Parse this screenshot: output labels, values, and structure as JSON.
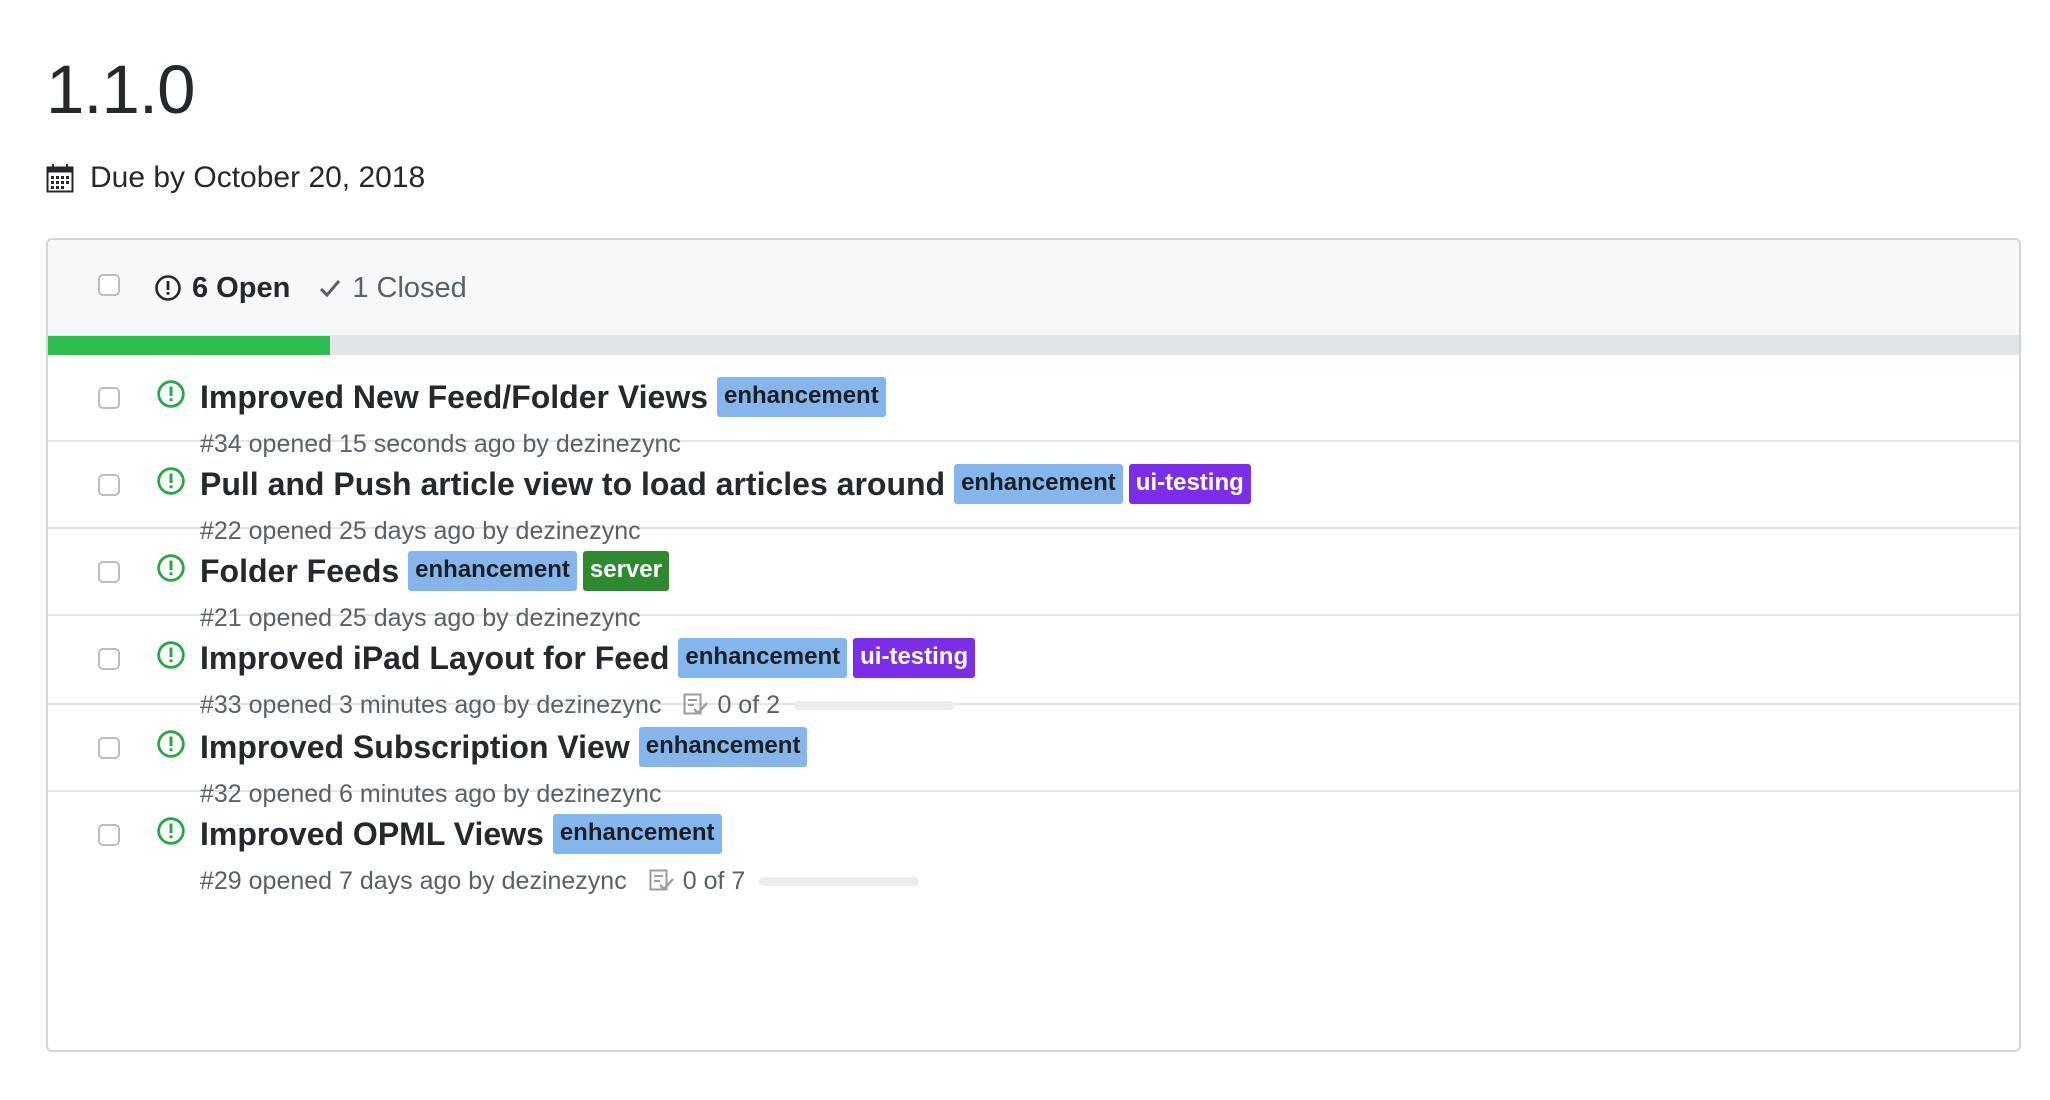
{
  "milestone": {
    "title": "1.1.0",
    "due_text": "Due by October 20, 2018",
    "progress_fraction": 0.143
  },
  "filters": {
    "open_label": "6 Open",
    "closed_label": "1 Closed"
  },
  "colors": {
    "enhancement": "#84b6eb",
    "ui-testing": "#7b2de8",
    "server": "#2e8a2e",
    "progress": "#2cbe4e",
    "open_icon": "#28a745"
  },
  "issues": [
    {
      "title": "Improved New Feed/Folder Views",
      "labels": [
        {
          "name": "enhancement",
          "key": "enhancement"
        }
      ],
      "meta": "#34 opened 15 seconds ago by dezinezync",
      "tasks": null
    },
    {
      "title": "Pull and Push article view to load articles around",
      "labels": [
        {
          "name": "enhancement",
          "key": "enhancement"
        },
        {
          "name": "ui-testing",
          "key": "ui-testing"
        }
      ],
      "meta": "#22 opened 25 days ago by dezinezync",
      "tasks": null
    },
    {
      "title": "Folder Feeds",
      "labels": [
        {
          "name": "enhancement",
          "key": "enhancement"
        },
        {
          "name": "server",
          "key": "server"
        }
      ],
      "meta": "#21 opened 25 days ago by dezinezync",
      "tasks": null
    },
    {
      "title": "Improved iPad Layout for Feed",
      "labels": [
        {
          "name": "enhancement",
          "key": "enhancement"
        },
        {
          "name": "ui-testing",
          "key": "ui-testing"
        }
      ],
      "meta": "#33 opened 3 minutes ago by dezinezync",
      "tasks": {
        "text": "0 of 2",
        "done_fraction": 0
      }
    },
    {
      "title": "Improved Subscription View",
      "labels": [
        {
          "name": "enhancement",
          "key": "enhancement"
        }
      ],
      "meta": "#32 opened 6 minutes ago by dezinezync",
      "tasks": null
    },
    {
      "title": "Improved OPML Views",
      "labels": [
        {
          "name": "enhancement",
          "key": "enhancement"
        }
      ],
      "meta": "#29 opened 7 days ago by dezinezync",
      "tasks": {
        "text": "0 of 7",
        "done_fraction": 0
      }
    }
  ]
}
